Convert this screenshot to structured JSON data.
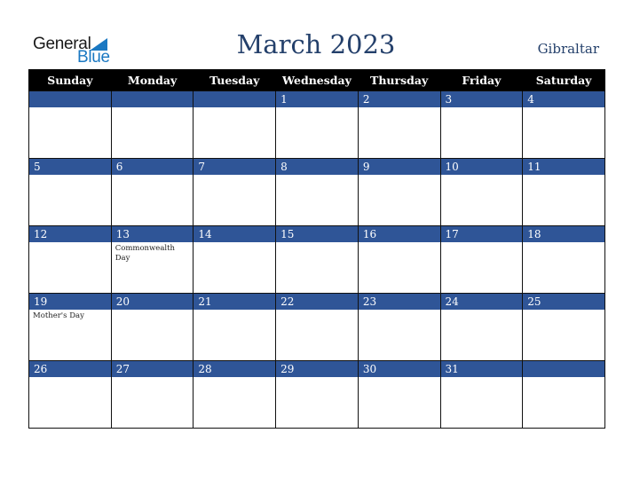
{
  "logo": {
    "general": "General",
    "blue": "Blue"
  },
  "header": {
    "title": "March 2023",
    "country": "Gibraltar"
  },
  "colors": {
    "accent": "#2f5597",
    "title": "#24406b",
    "header_bg": "#000000",
    "logo_blue": "#1a78c2"
  },
  "weekdays": [
    "Sunday",
    "Monday",
    "Tuesday",
    "Wednesday",
    "Thursday",
    "Friday",
    "Saturday"
  ],
  "weeks": [
    [
      {
        "day": "",
        "event": ""
      },
      {
        "day": "",
        "event": ""
      },
      {
        "day": "",
        "event": ""
      },
      {
        "day": "1",
        "event": ""
      },
      {
        "day": "2",
        "event": ""
      },
      {
        "day": "3",
        "event": ""
      },
      {
        "day": "4",
        "event": ""
      }
    ],
    [
      {
        "day": "5",
        "event": ""
      },
      {
        "day": "6",
        "event": ""
      },
      {
        "day": "7",
        "event": ""
      },
      {
        "day": "8",
        "event": ""
      },
      {
        "day": "9",
        "event": ""
      },
      {
        "day": "10",
        "event": ""
      },
      {
        "day": "11",
        "event": ""
      }
    ],
    [
      {
        "day": "12",
        "event": ""
      },
      {
        "day": "13",
        "event": "Commonwealth Day"
      },
      {
        "day": "14",
        "event": ""
      },
      {
        "day": "15",
        "event": ""
      },
      {
        "day": "16",
        "event": ""
      },
      {
        "day": "17",
        "event": ""
      },
      {
        "day": "18",
        "event": ""
      }
    ],
    [
      {
        "day": "19",
        "event": "Mother's Day"
      },
      {
        "day": "20",
        "event": ""
      },
      {
        "day": "21",
        "event": ""
      },
      {
        "day": "22",
        "event": ""
      },
      {
        "day": "23",
        "event": ""
      },
      {
        "day": "24",
        "event": ""
      },
      {
        "day": "25",
        "event": ""
      }
    ],
    [
      {
        "day": "26",
        "event": ""
      },
      {
        "day": "27",
        "event": ""
      },
      {
        "day": "28",
        "event": ""
      },
      {
        "day": "29",
        "event": ""
      },
      {
        "day": "30",
        "event": ""
      },
      {
        "day": "31",
        "event": ""
      },
      {
        "day": "",
        "event": ""
      }
    ]
  ]
}
